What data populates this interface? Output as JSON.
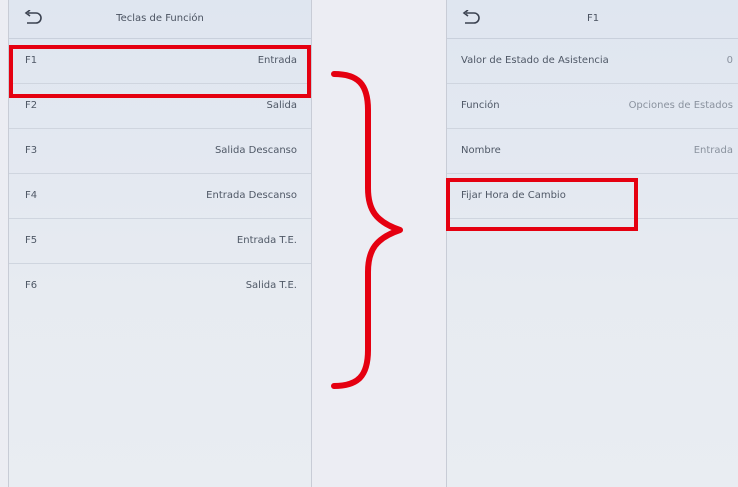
{
  "left_screen": {
    "title": "Teclas de Función",
    "items": [
      {
        "key": "F1",
        "value": "Entrada"
      },
      {
        "key": "F2",
        "value": "Salida"
      },
      {
        "key": "F3",
        "value": "Salida Descanso"
      },
      {
        "key": "F4",
        "value": "Entrada Descanso"
      },
      {
        "key": "F5",
        "value": "Entrada T.E."
      },
      {
        "key": "F6",
        "value": "Salida T.E."
      }
    ]
  },
  "right_screen": {
    "title": "F1",
    "items": [
      {
        "key": "Valor de Estado de Asistencia",
        "value": "0"
      },
      {
        "key": "Función",
        "value": "Opciones de Estados"
      },
      {
        "key": "Nombre",
        "value": "Entrada"
      },
      {
        "key": "Fijar Hora de Cambio",
        "value": ""
      }
    ]
  },
  "colors": {
    "highlight": "#e50010",
    "screen_bg": "#e3e8f1"
  },
  "icons": {
    "back": "return-arrow-icon"
  }
}
